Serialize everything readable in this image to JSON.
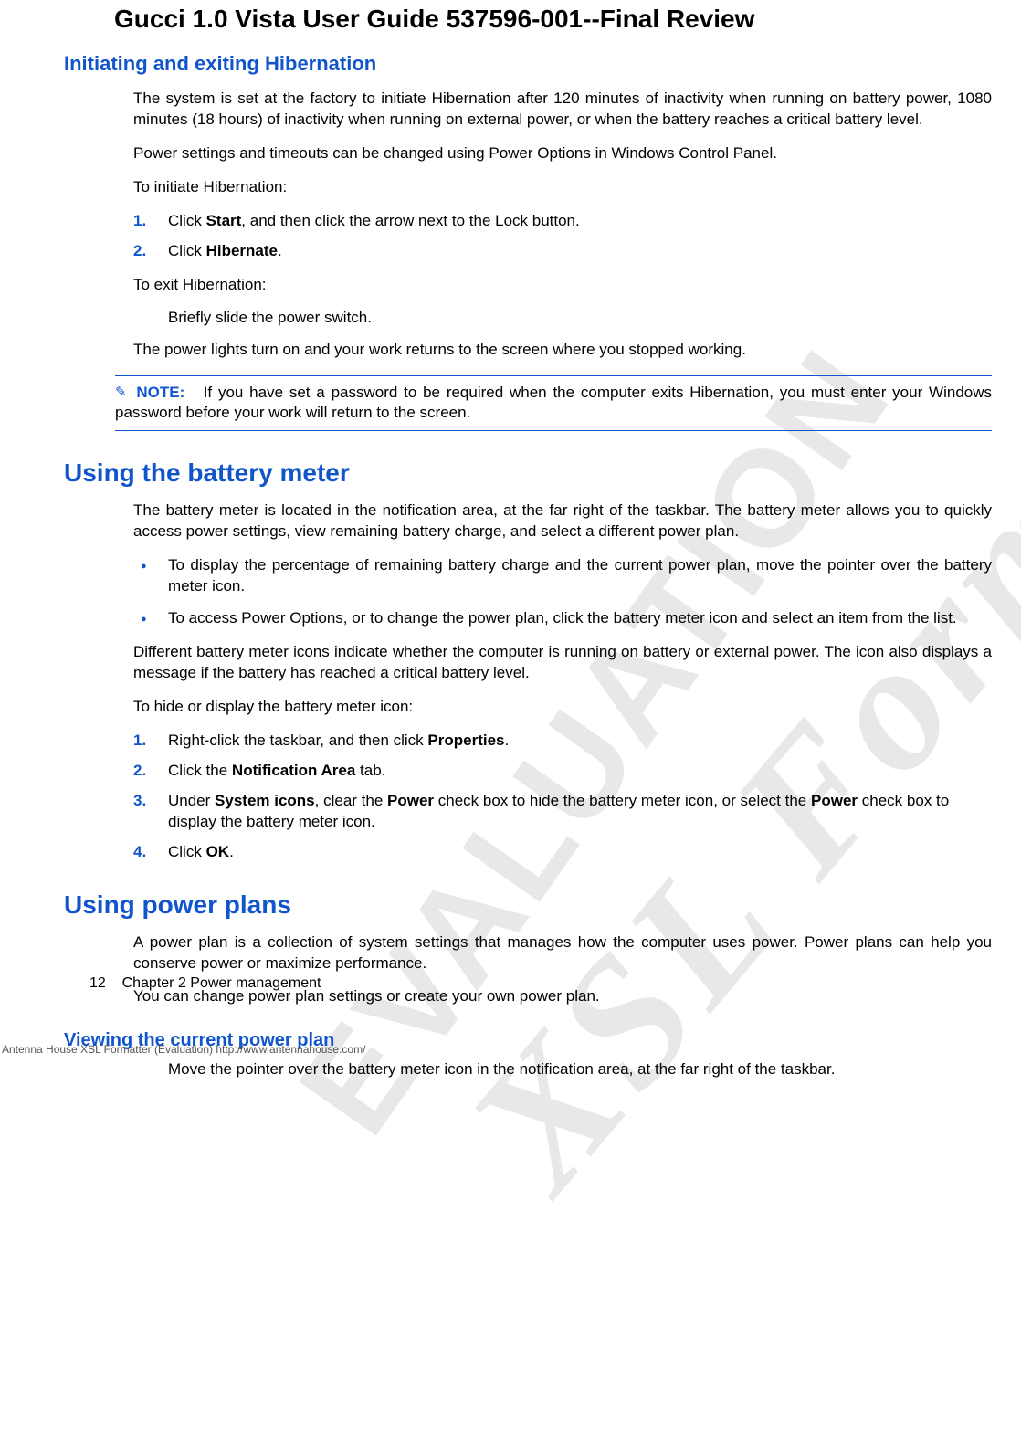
{
  "watermarks": {
    "wm1": "XSL Formatter",
    "wm2": "EVALUATION"
  },
  "docTitle": "Gucci 1.0 Vista User Guide 537596-001--Final Review",
  "s1": {
    "heading": "Initiating and exiting Hibernation",
    "p1": "The system is set at the factory to initiate Hibernation after 120 minutes of inactivity when running on battery power, 1080 minutes (18 hours) of inactivity when running on external power, or when the battery reaches a critical battery level.",
    "p2": "Power settings and timeouts can be changed using Power Options in Windows Control Panel.",
    "p3": "To initiate Hibernation:",
    "ol1_1a": "Click ",
    "ol1_1b": "Start",
    "ol1_1c": ", and then click the arrow next to the Lock button.",
    "ol1_2a": "Click ",
    "ol1_2b": "Hibernate",
    "ol1_2c": ".",
    "p4": "To exit Hibernation:",
    "sub1": "Briefly slide the power switch.",
    "p5": "The power lights turn on and your work returns to the screen where you stopped working.",
    "noteLabel": "NOTE:",
    "noteText": "If you have set a password to be required when the computer exits Hibernation, you must enter your Windows password before your work will return to the screen."
  },
  "s2": {
    "heading": "Using the battery meter",
    "p1": "The battery meter is located in the notification area, at the far right of the taskbar. The battery meter allows you to quickly access power settings, view remaining battery charge, and select a different power plan.",
    "b1": "To display the percentage of remaining battery charge and the current power plan, move the pointer over the battery meter icon.",
    "b2": "To access Power Options, or to change the power plan, click the battery meter icon and select an item from the list.",
    "p2": "Different battery meter icons indicate whether the computer is running on battery or external power. The icon also displays a message if the battery has reached a critical battery level.",
    "p3": "To hide or display the battery meter icon:",
    "ol_1a": "Right-click the taskbar, and then click ",
    "ol_1b": "Properties",
    "ol_1c": ".",
    "ol_2a": "Click the ",
    "ol_2b": "Notification Area",
    "ol_2c": " tab.",
    "ol_3a": "Under ",
    "ol_3b": "System icons",
    "ol_3c": ", clear the ",
    "ol_3d": "Power",
    "ol_3e": " check box to hide the battery meter icon, or select the ",
    "ol_3f": "Power",
    "ol_3g": " check box to display the battery meter icon.",
    "ol_4a": "Click ",
    "ol_4b": "OK",
    "ol_4c": "."
  },
  "s3": {
    "heading": "Using power plans",
    "p1": "A power plan is a collection of system settings that manages how the computer uses power. Power plans can help you conserve power or maximize performance.",
    "p2": "You can change power plan settings or create your own power plan."
  },
  "s4": {
    "heading": "Viewing the current power plan",
    "sub1": "Move the pointer over the battery meter icon in the notification area, at the far right of the taskbar."
  },
  "footer": {
    "pageNum": "12",
    "chapter": "Chapter 2   Power management",
    "eval": "Antenna House XSL Formatter (Evaluation)  http://www.antennahouse.com/"
  }
}
